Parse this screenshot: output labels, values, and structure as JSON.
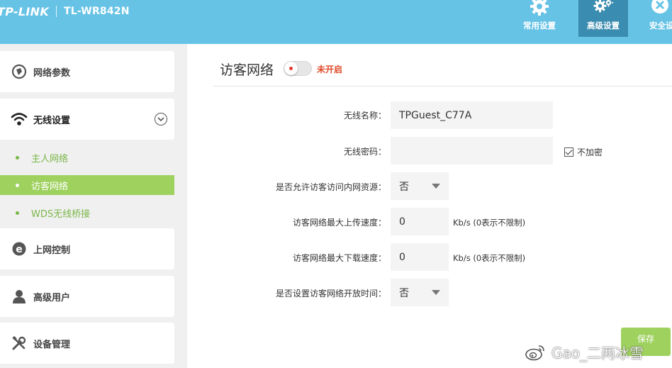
{
  "header": {
    "brand": "TP-LINK",
    "model": "TL-WR842N",
    "nav": [
      {
        "label": "常用设置",
        "icon": "gear-icon"
      },
      {
        "label": "高级设置",
        "icon": "gears-icon"
      },
      {
        "label": "安全设",
        "icon": "close-circle-icon"
      }
    ]
  },
  "sidebar": {
    "items": [
      {
        "label": "网络参数",
        "icon": "globe-icon"
      },
      {
        "label": "无线设置",
        "icon": "wifi-icon"
      },
      {
        "label": "上网控制",
        "icon": "browser-e-icon"
      },
      {
        "label": "高级用户",
        "icon": "user-icon"
      },
      {
        "label": "设备管理",
        "icon": "tools-icon"
      }
    ],
    "wireless_sub": [
      {
        "label": "主人网络",
        "active": false
      },
      {
        "label": "访客网络",
        "active": true
      },
      {
        "label": "WDS无线桥接",
        "active": false
      }
    ]
  },
  "main": {
    "title": "访客网络",
    "toggle_status": "未开启",
    "fields": {
      "ssid_label": "无线名称：",
      "ssid_value": "TPGuest_C77A",
      "password_label": "无线密码：",
      "password_value": "",
      "no_encrypt_label": "不加密",
      "no_encrypt_checked": true,
      "allow_lan_label": "是否允许访客访问内网资源：",
      "allow_lan_value": "否",
      "upload_label": "访客网络最大上传速度：",
      "upload_value": "0",
      "upload_unit": "Kb/s (0表示不限制)",
      "download_label": "访客网络最大下载速度：",
      "download_value": "0",
      "download_unit": "Kb/s (0表示不限制)",
      "schedule_label": "是否设置访客网络开放时间：",
      "schedule_value": "否"
    },
    "save_label": "保存"
  },
  "watermark": "Gao_二两冰雪",
  "colors": {
    "header": "#67c3e6",
    "header_active": "#3a8cb0",
    "accent_green": "#9fd15f",
    "status_red": "#e04a2a"
  }
}
